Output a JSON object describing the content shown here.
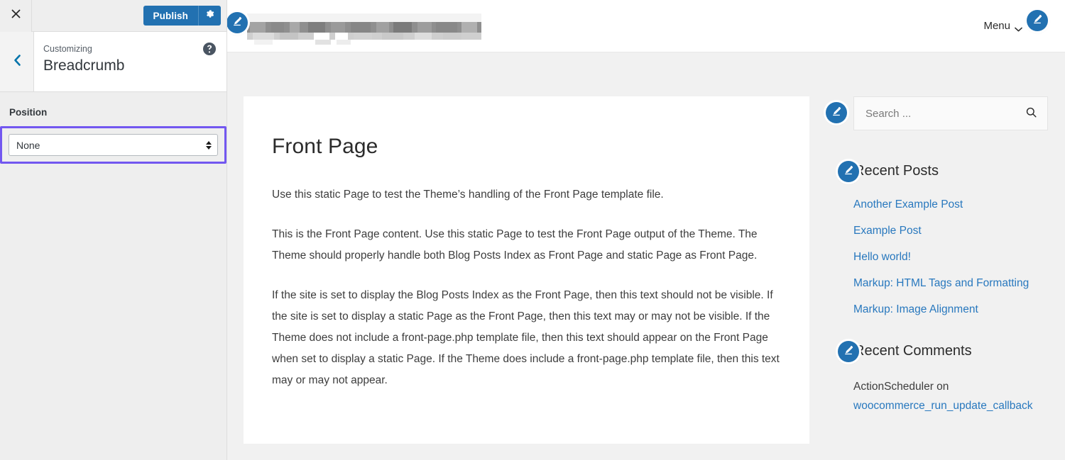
{
  "customizer": {
    "close_label": "Close",
    "close_icon": "close-icon",
    "publish_label": "Publish",
    "gear_icon": "gear-icon",
    "back_icon": "chevron-left-icon",
    "help_icon": "help-circle-icon",
    "eyebrow": "Customizing",
    "section_title": "Breadcrumb",
    "control": {
      "label": "Position",
      "selected_value": "None",
      "options": [
        "None"
      ],
      "highlight_color": "#7257f0"
    },
    "accent_color": "#0073aa",
    "publish_color": "#2271b1"
  },
  "preview": {
    "header": {
      "site_title": "",
      "site_title_state": "blurred",
      "menu_label": "Menu",
      "menu_chevron_icon": "chevron-down-icon",
      "edit_icon": "pencil-edit-icon"
    },
    "content": {
      "page_title": "Front Page",
      "paragraphs": [
        "Use this static Page to test the Theme’s handling of the Front Page template file.",
        "This is the Front Page content. Use this static Page to test the Front Page output of the Theme. The Theme should properly handle both Blog Posts Index as Front Page and static Page as Front Page.",
        "If the site is set to display the Blog Posts Index as the Front Page, then this text should not be visible. If the site is set to display a static Page as the Front Page, then this text may or may not be visible. If the Theme does not include a front-page.php template file, then this text should appear on the Front Page when set to display a static Page. If the Theme does include a front-page.php template file, then this text may or may not appear."
      ]
    },
    "widgets": {
      "search": {
        "placeholder": "Search ...",
        "value": "",
        "search_icon": "search-icon",
        "edit_icon": "pencil-edit-icon"
      },
      "recent_posts": {
        "title": "Recent Posts",
        "edit_icon": "pencil-edit-icon",
        "items": [
          "Another Example Post",
          "Example Post",
          "Hello world!",
          "Markup: HTML Tags and Formatting",
          "Markup: Image Alignment"
        ]
      },
      "recent_comments": {
        "title": "Recent Comments",
        "edit_icon": "pencil-edit-icon",
        "items": [
          {
            "author": "ActionScheduler on",
            "link": "woocommerce_run_update_callback"
          }
        ]
      },
      "link_color": "#2878be"
    }
  }
}
